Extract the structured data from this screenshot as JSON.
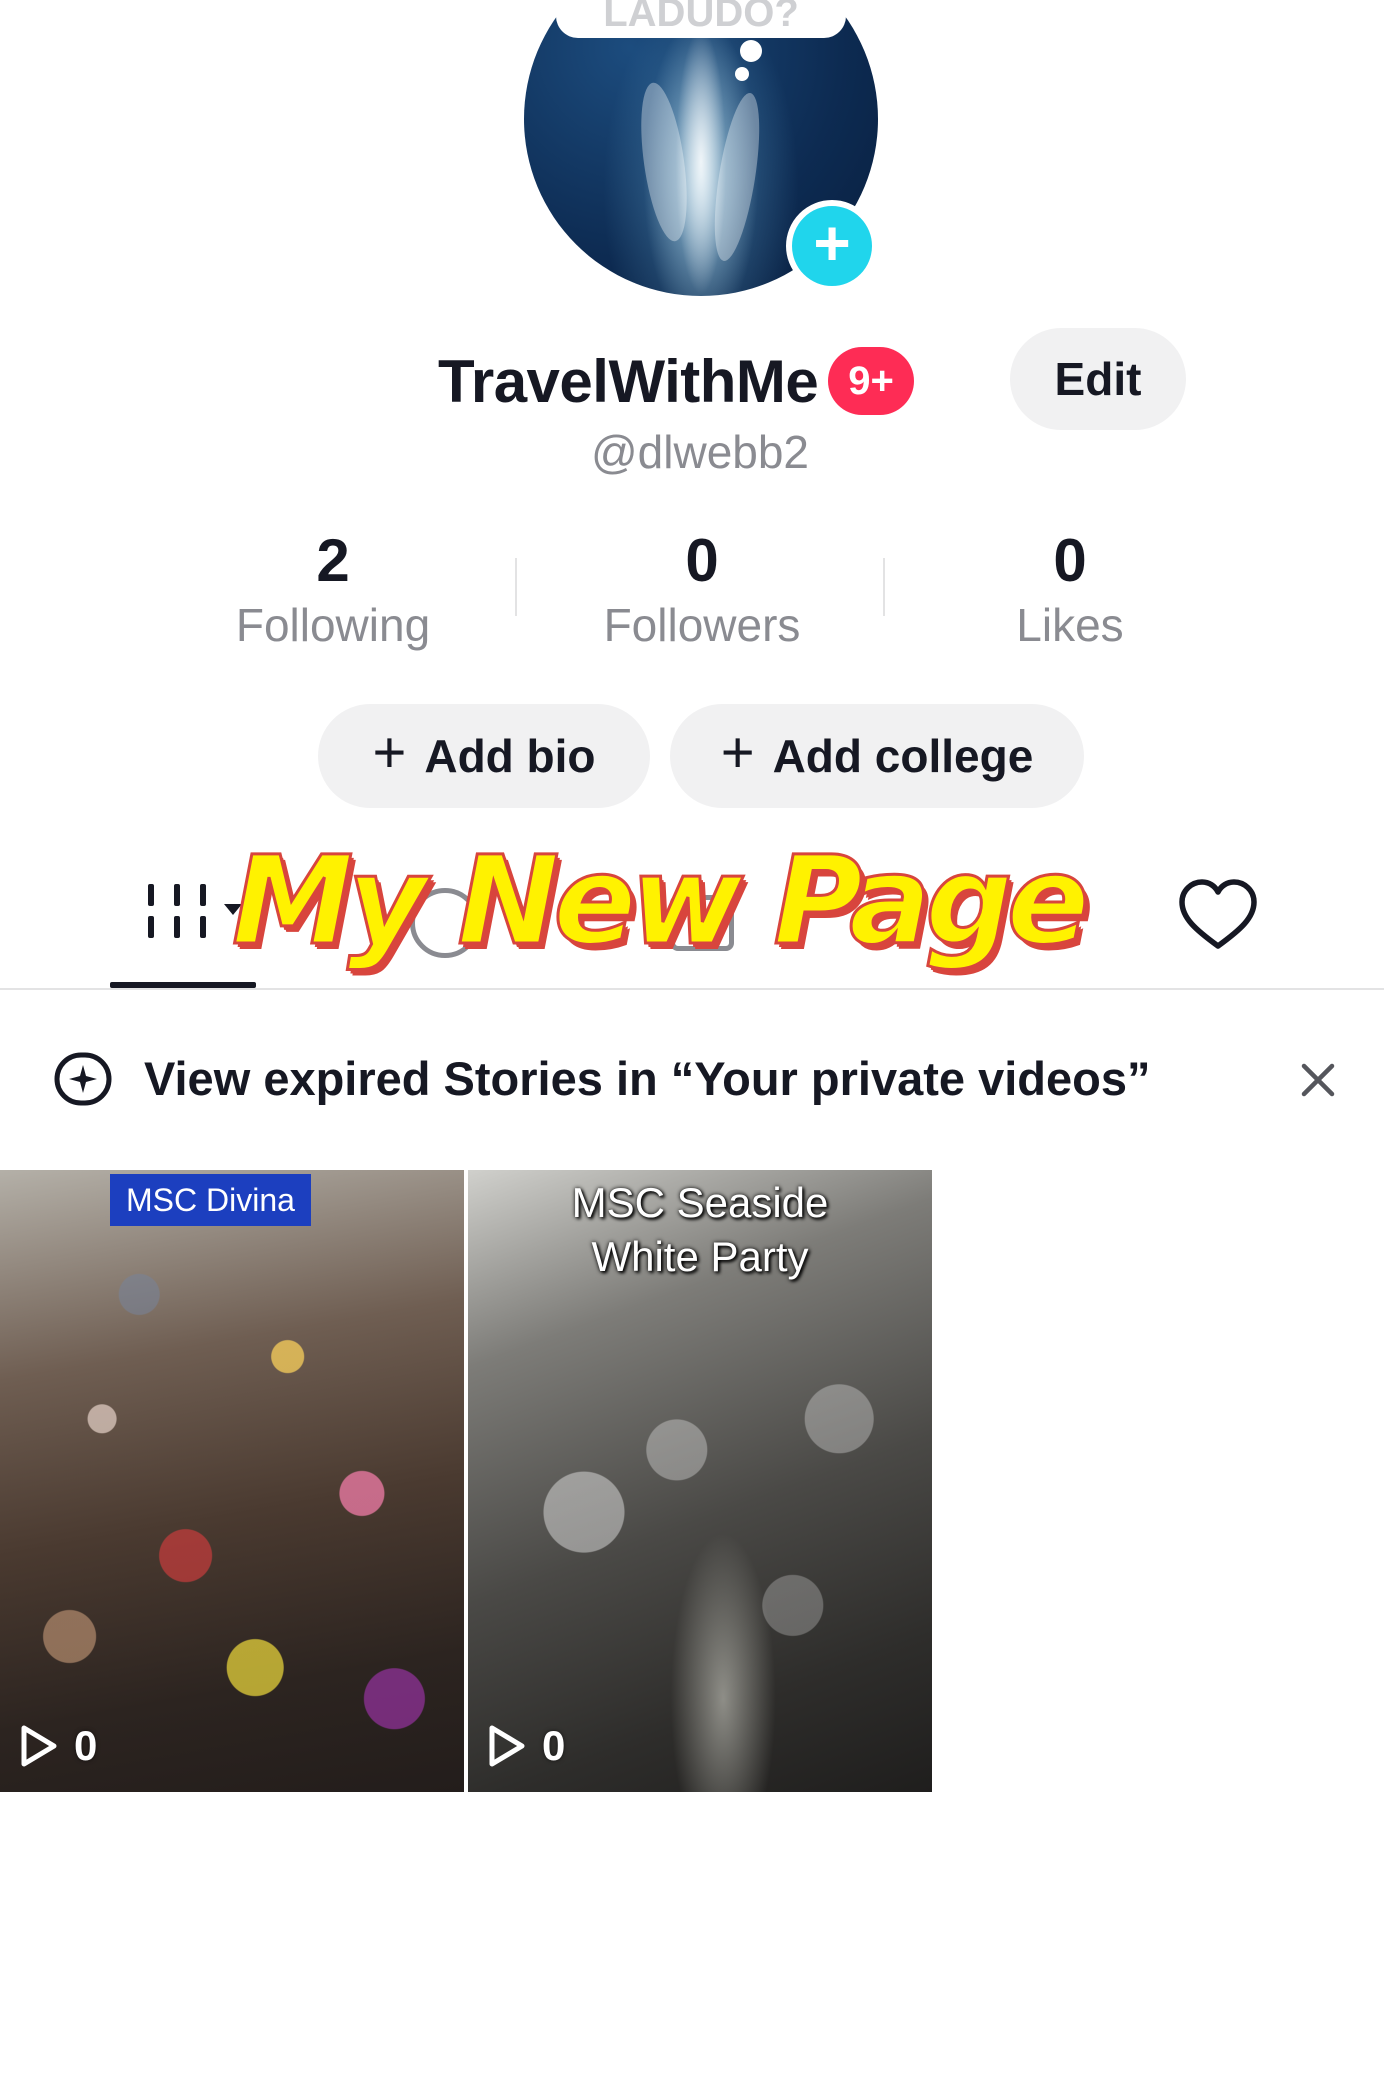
{
  "avatar": {
    "bubble_text": "LADUDO?"
  },
  "profile": {
    "display_name": "TravelWithMe",
    "notification_badge": "9+",
    "edit_label": "Edit",
    "handle": "@dlwebb2"
  },
  "stats": [
    {
      "value": "2",
      "label": "Following"
    },
    {
      "value": "0",
      "label": "Followers"
    },
    {
      "value": "0",
      "label": "Likes"
    }
  ],
  "actions": {
    "add_bio": "Add bio",
    "add_college": "Add college",
    "plus": "+"
  },
  "overlay": {
    "title": "My New Page"
  },
  "banner": {
    "text": "View expired Stories in “Your private videos”"
  },
  "videos": [
    {
      "caption": "MSC Divina",
      "plays": "0"
    },
    {
      "caption": "MSC Seaside\nWhite Party",
      "plays": "0"
    }
  ],
  "colors": {
    "accent_red": "#fe2c55",
    "accent_cyan": "#20d5ec",
    "overlay_yellow": "#fff200",
    "overlay_stroke": "#d8453d"
  }
}
